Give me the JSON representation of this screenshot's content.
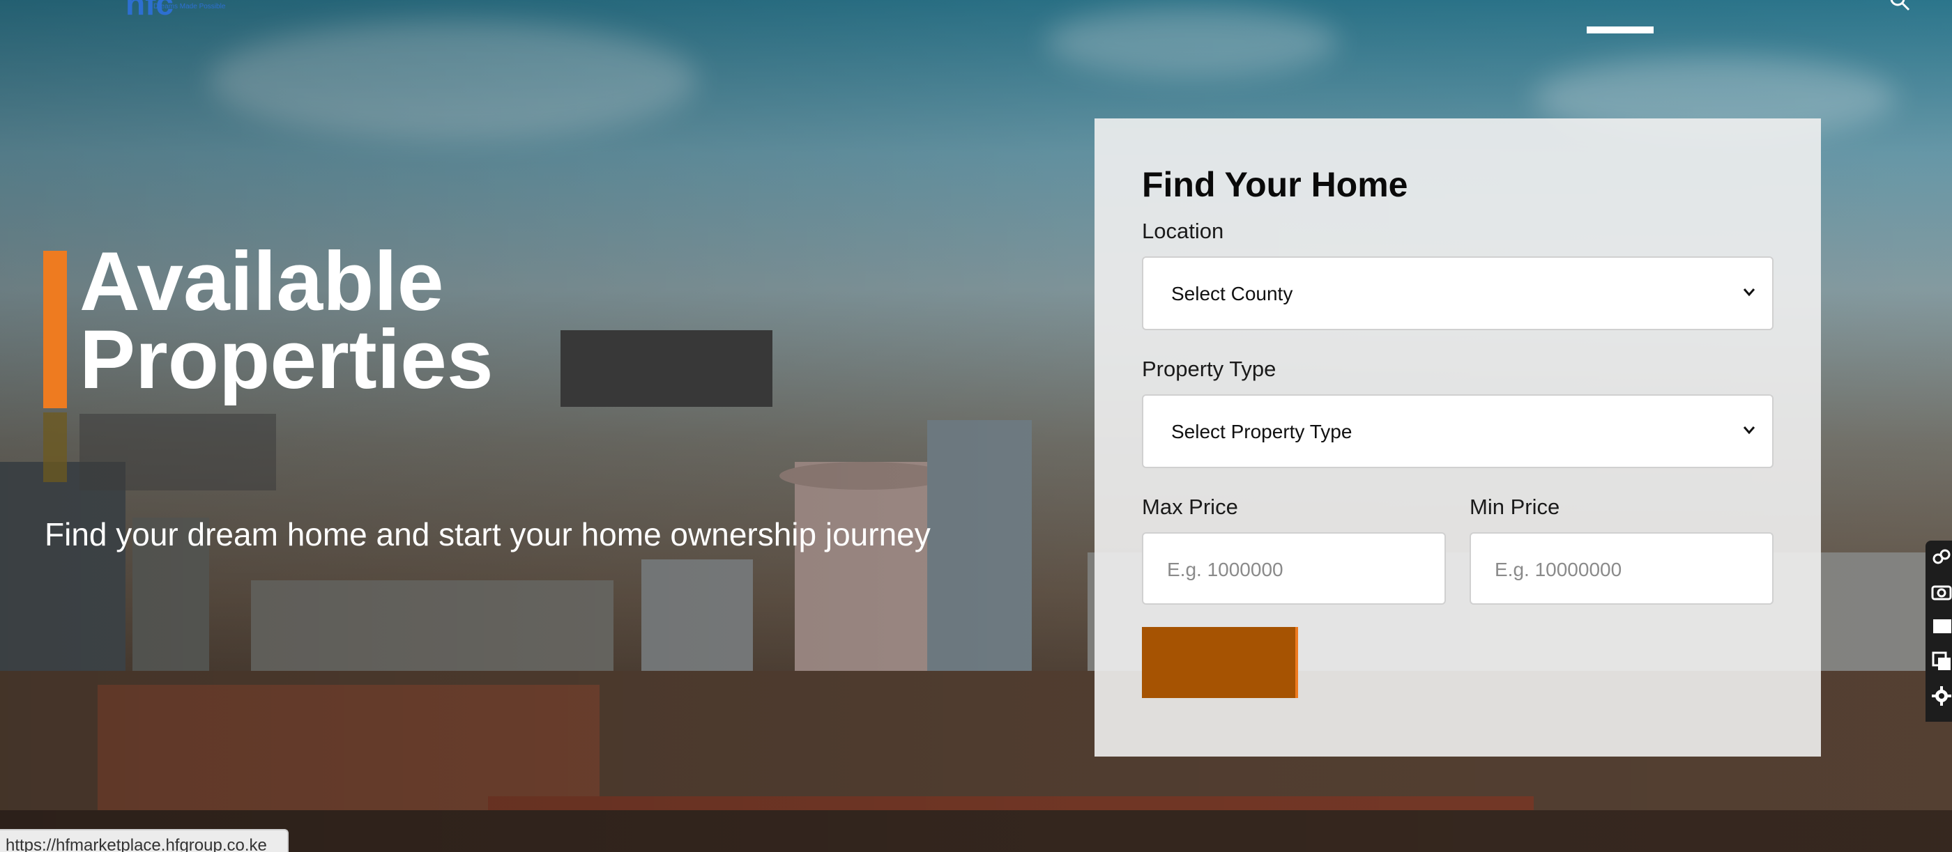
{
  "header": {
    "logo_text": "hfc",
    "logo_tagline": "Dreams Made Possible",
    "icons": [
      "search-icon"
    ]
  },
  "hero": {
    "title": "Available Properties",
    "subtitle": "Find your dream home and start your home ownership journey"
  },
  "search_form": {
    "title": "Find Your Home",
    "location_label": "Location",
    "location_selected": "Select County",
    "property_type_label": "Property Type",
    "property_type_selected": "Select Property Type",
    "max_price_label": "Max Price",
    "max_price_placeholder": "E.g. 1000000",
    "min_price_label": "Min Price",
    "min_price_placeholder": "E.g. 10000000",
    "search_button_label": ""
  },
  "status_bar": {
    "url": "https://hfmarketplace.hfgroup.co.ke"
  },
  "side_toolbar": {
    "icons": [
      "link-icon",
      "camera-icon",
      "square-icon",
      "copy-icon",
      "gear-icon"
    ]
  },
  "colors": {
    "accent": "#ee7b20",
    "button": "#a65302",
    "panel": "#f0f0f0",
    "text": "#0a0a0a"
  }
}
